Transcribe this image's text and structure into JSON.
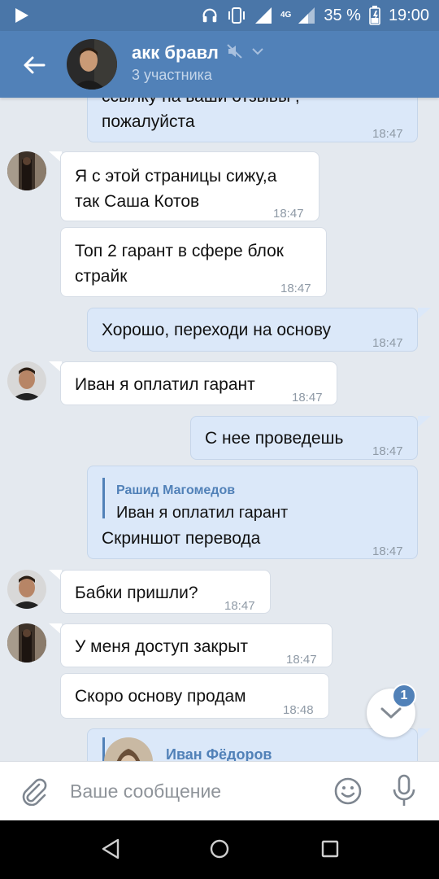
{
  "status_bar": {
    "network": "4G",
    "battery": "35 %",
    "time": "19:00"
  },
  "header": {
    "title": "акк бравл",
    "subtitle": "3 участника"
  },
  "messages": [
    {
      "dir": "out",
      "line1": "ссылку на ваши отзывы ,",
      "line2": "пожалуйста",
      "time": "18:47"
    },
    {
      "dir": "in",
      "line1": "Я с этой страницы сижу,а",
      "line2": "так Саша Котов",
      "time": "18:47",
      "avatar": "user-a"
    },
    {
      "dir": "in",
      "line1": "Топ 2 гарант в сфере блок",
      "line2": "страйк",
      "time": "18:47"
    },
    {
      "dir": "out",
      "line1": "Хорошо, переходи на основу",
      "time": "18:47"
    },
    {
      "dir": "in",
      "line1": "Иван я оплатил гарант",
      "time": "18:47",
      "avatar": "user-b"
    },
    {
      "dir": "out",
      "line1": "С нее проведешь",
      "time": "18:47"
    },
    {
      "dir": "out",
      "reply_author": "Рашид Магомедов",
      "reply_text": "Иван я оплатил гарант",
      "line1": "Скриншот перевода",
      "time": "18:47"
    },
    {
      "dir": "in",
      "line1": "Бабки пришли?",
      "time": "18:47",
      "avatar": "user-b"
    },
    {
      "dir": "in",
      "line1": "У меня доступ закрыт",
      "time": "18:47",
      "avatar": "user-a"
    },
    {
      "dir": "in",
      "line1": "Скоро основу продам",
      "time": "18:48"
    },
    {
      "dir": "out",
      "reply_author": "Иван Фёдоров"
    }
  ],
  "scroll_button": {
    "unread_count": "1"
  },
  "composer": {
    "placeholder": "Ваше сообщение"
  },
  "icons": {
    "back": "arrow-left-icon",
    "mute": "muted-speaker-icon",
    "attach": "paperclip-icon",
    "emoji": "smile-icon",
    "mic": "microphone-icon"
  },
  "colors": {
    "header": "#5181b8",
    "status_bar": "#4a76a8",
    "chat_bg": "#e4e9ef",
    "incoming": "#ffffff",
    "outgoing": "#dbe8f9",
    "accent": "#5181b8"
  }
}
